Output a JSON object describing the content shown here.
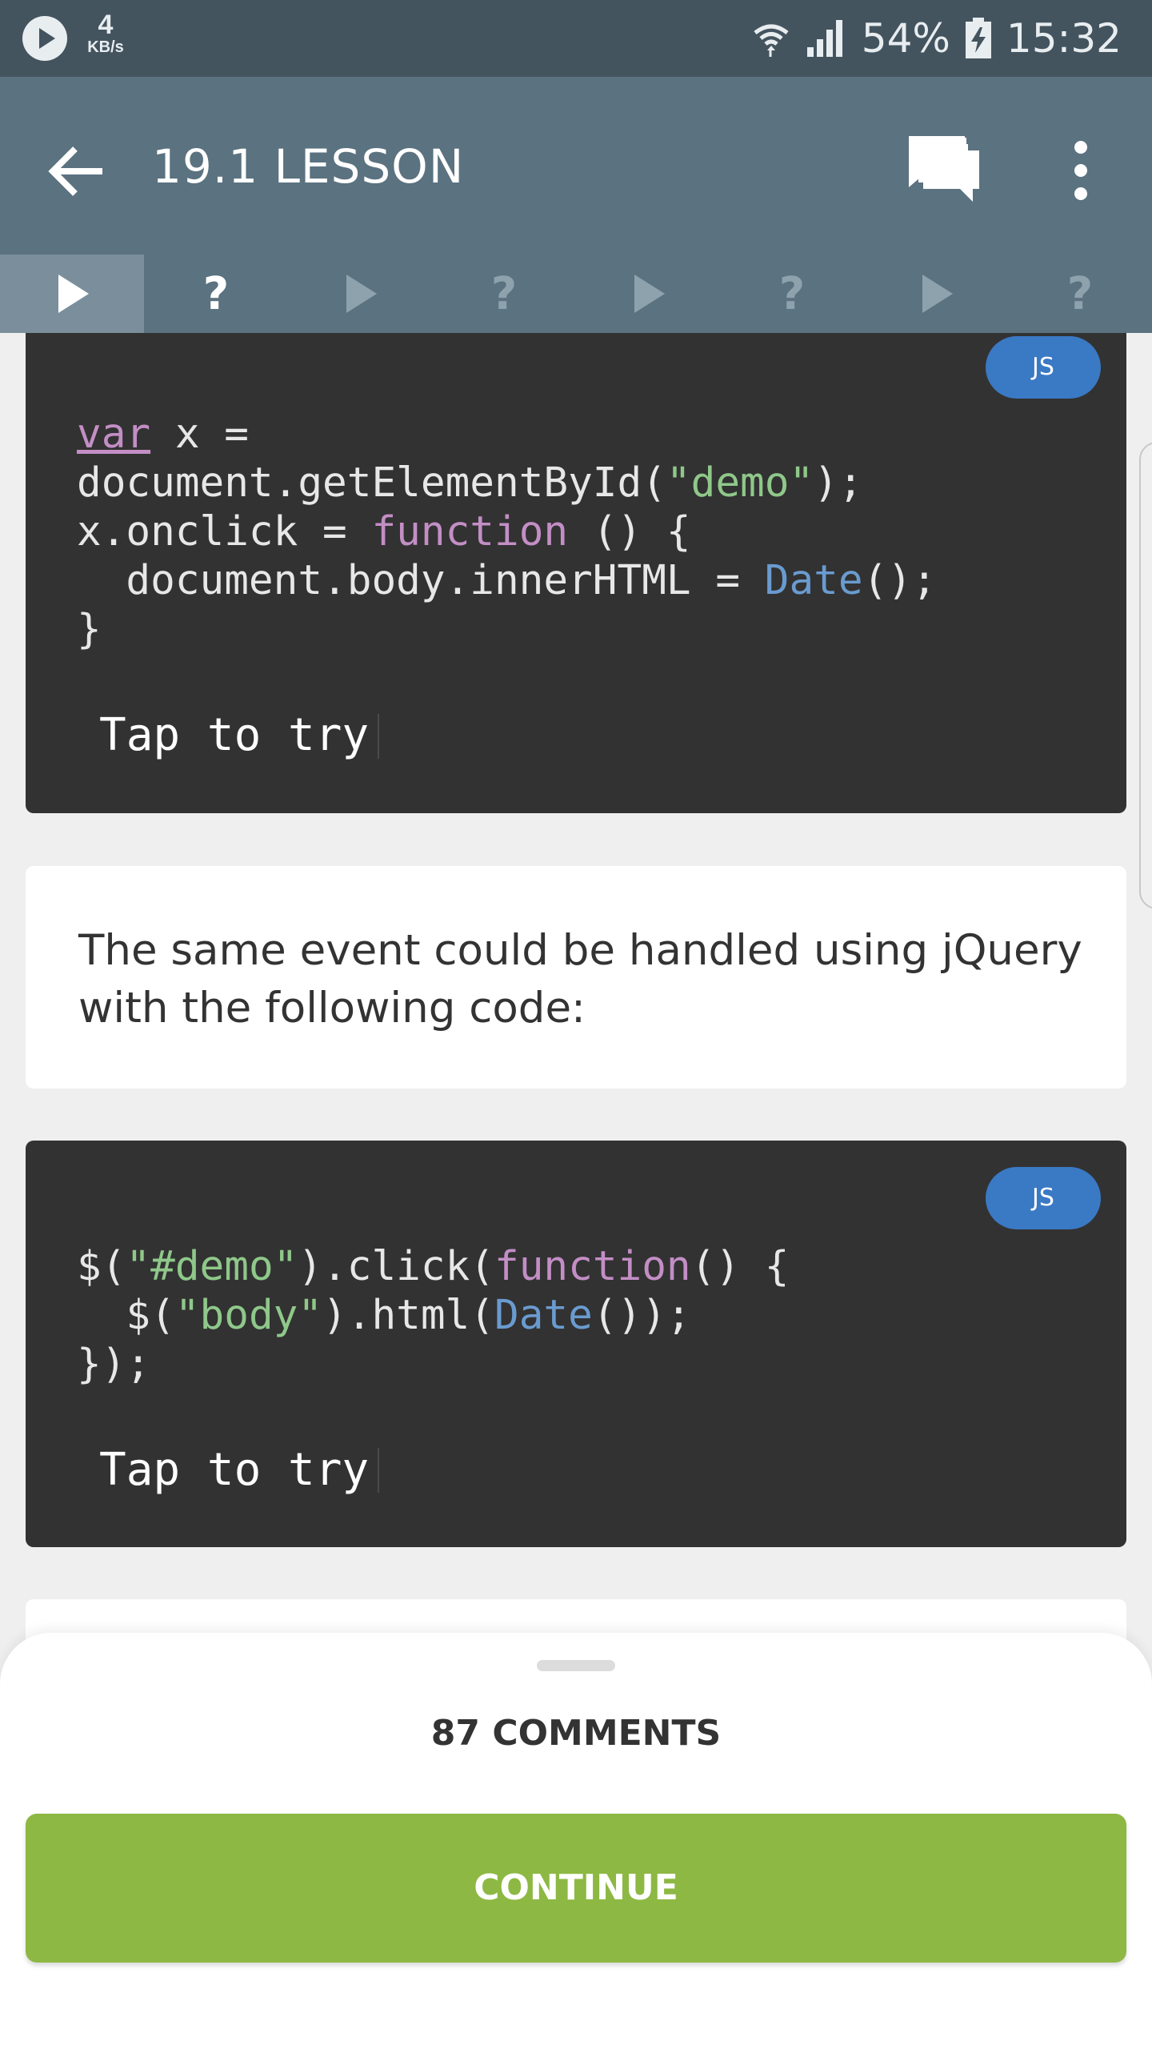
{
  "status_bar": {
    "speed_value": "4",
    "speed_unit": "KB/s",
    "battery": "54%",
    "time": "15:32"
  },
  "app_bar": {
    "title": "19.1 LESSON"
  },
  "tabs": [
    {
      "type": "play",
      "active": true
    },
    {
      "type": "question",
      "active": true
    },
    {
      "type": "play",
      "active": false
    },
    {
      "type": "question",
      "active": false
    },
    {
      "type": "play",
      "active": false
    },
    {
      "type": "question",
      "active": false
    },
    {
      "type": "play",
      "active": false
    },
    {
      "type": "question",
      "active": false
    }
  ],
  "tab_question_label": "?",
  "code_block_1": {
    "badge": "JS",
    "lines": [
      "var x =",
      "document.getElementById(\"demo\");",
      "x.onclick = function () {",
      "  document.body.innerHTML = Date();",
      "}"
    ],
    "tap_label": "Tap to try"
  },
  "explanation": {
    "text": "The same event could be handled using jQuery with the following code:"
  },
  "code_block_2": {
    "badge": "JS",
    "lines": [
      "$(\"#demo\").click(function() {",
      "  $(\"body\").html(Date());",
      "});"
    ],
    "tap_label": "Tap to try"
  },
  "bottom_sheet": {
    "comments_label": "87 COMMENTS",
    "continue_label": "CONTINUE"
  },
  "colors": {
    "status_bar": "#44545f",
    "app_bar": "#5b7280",
    "code_background": "#323232",
    "badge": "#3a79c4",
    "continue_button": "#8db843"
  }
}
